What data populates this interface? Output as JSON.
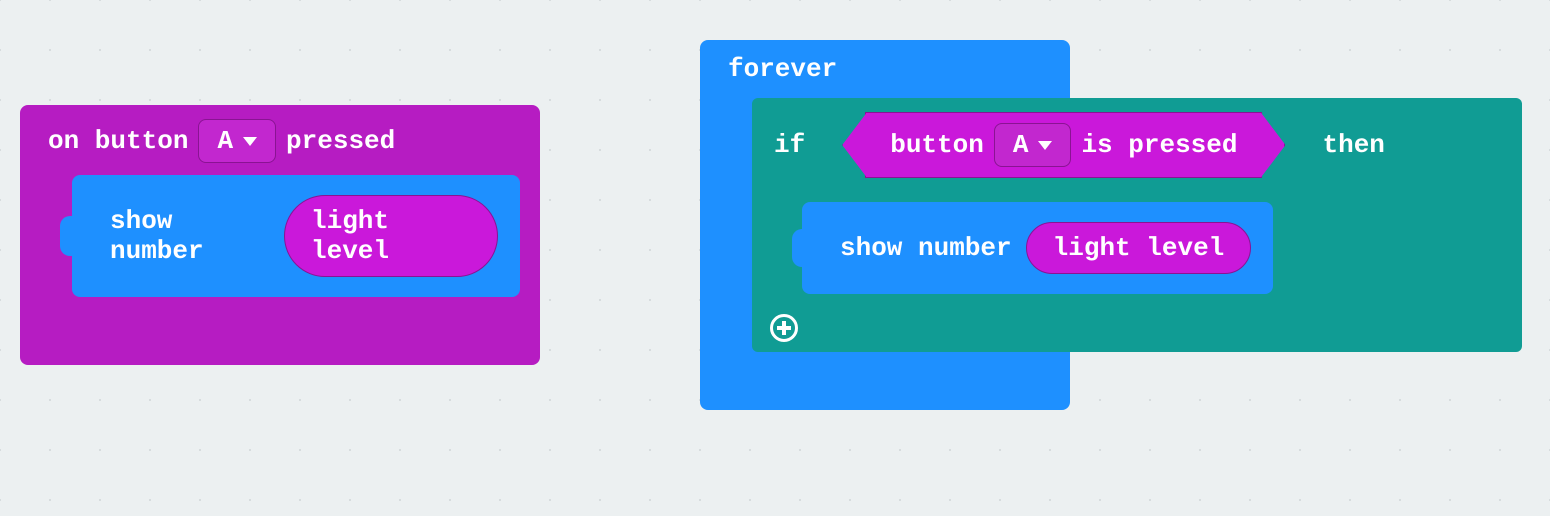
{
  "left_stack": {
    "hat": {
      "prefix": "on button",
      "dropdown": "A",
      "suffix": "pressed"
    },
    "show_number": {
      "label": "show number",
      "arg": "light level"
    }
  },
  "right_stack": {
    "forever": "forever",
    "if_block": {
      "if": "if",
      "then": "then",
      "cond": {
        "prefix": "button",
        "dropdown": "A",
        "suffix": "is pressed"
      }
    },
    "show_number": {
      "label": "show number",
      "arg": "light level"
    }
  }
}
